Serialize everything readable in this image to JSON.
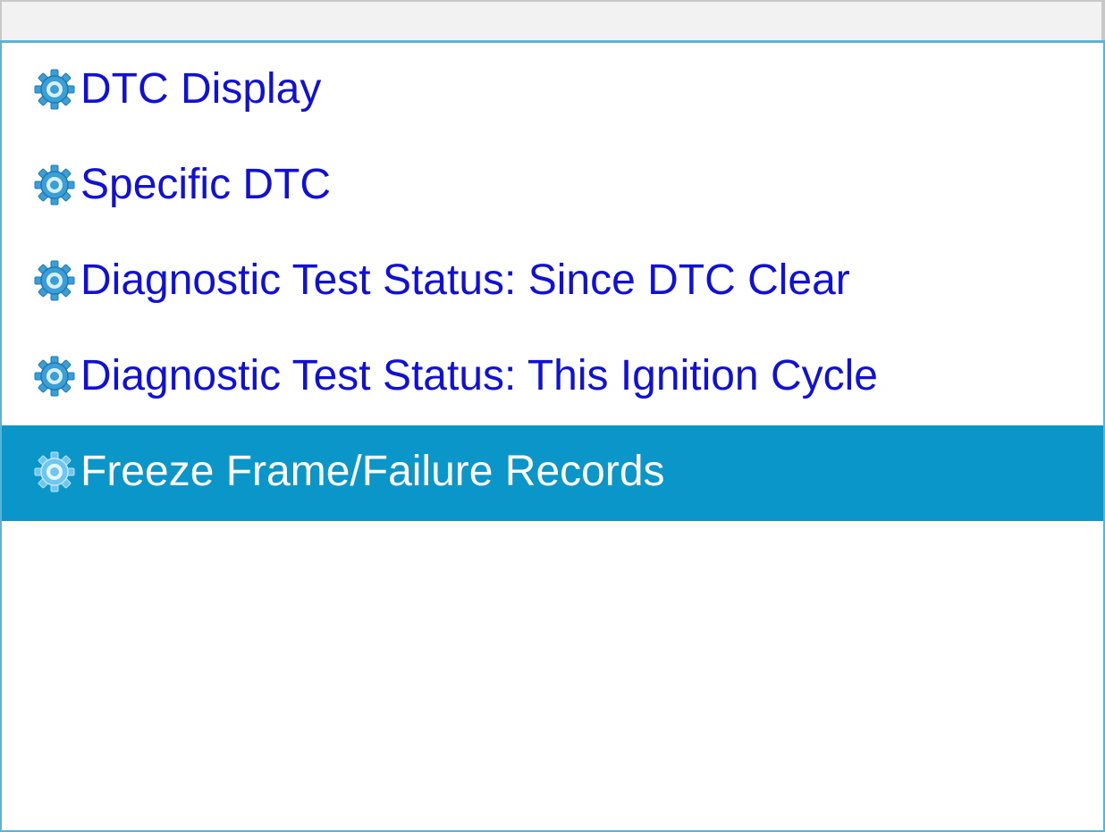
{
  "menu": {
    "items": [
      {
        "label": "DTC Display",
        "icon": "gear-icon",
        "selected": false
      },
      {
        "label": "Specific DTC",
        "icon": "gear-icon",
        "selected": false
      },
      {
        "label": "Diagnostic Test Status: Since DTC Clear",
        "icon": "gear-icon",
        "selected": false
      },
      {
        "label": "Diagnostic Test Status: This Ignition Cycle",
        "icon": "gear-icon",
        "selected": false
      },
      {
        "label": "Freeze Frame/Failure Records",
        "icon": "gear-icon",
        "selected": true
      }
    ]
  },
  "colors": {
    "item_text": "#1010d8",
    "selected_background": "#0a96c8",
    "selected_text": "#ffffff",
    "panel_border": "#5ab4d6",
    "title_bar_background": "#f2f2f2"
  }
}
